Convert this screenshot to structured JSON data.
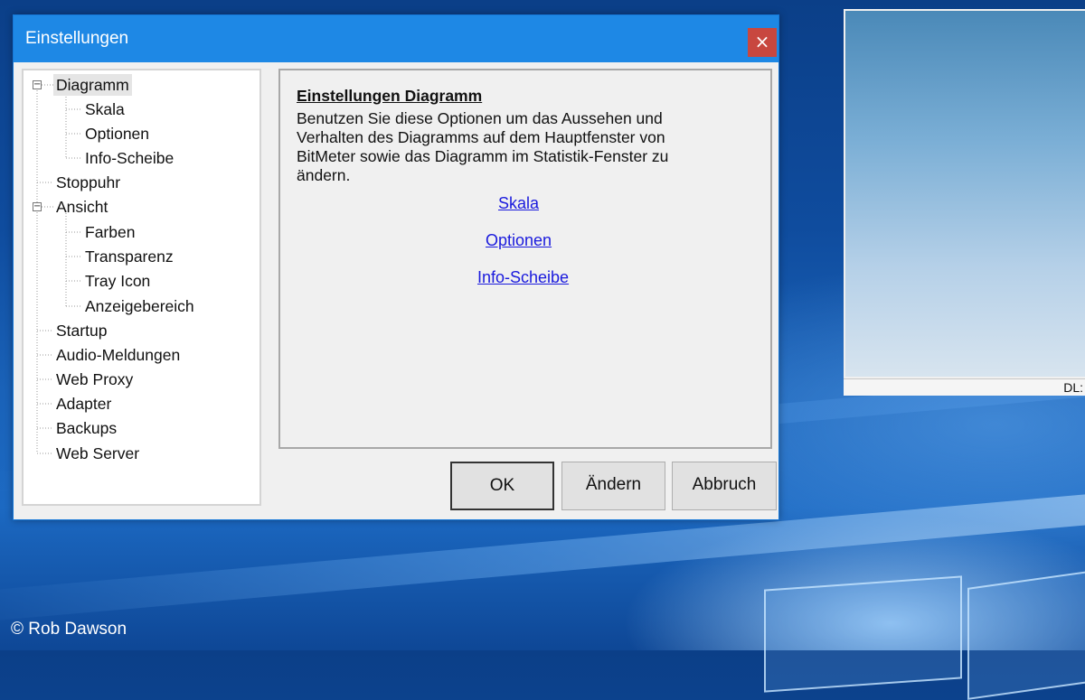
{
  "dialog": {
    "title": "Einstellungen",
    "close_glyph": "×",
    "buttons": {
      "ok": "OK",
      "apply": "Ändern",
      "cancel": "Abbruch"
    }
  },
  "tree": {
    "items": [
      {
        "label": "Diagramm",
        "expanded": true,
        "selected": true
      },
      {
        "label": "Skala"
      },
      {
        "label": "Optionen"
      },
      {
        "label": "Info-Scheibe"
      },
      {
        "label": "Stoppuhr"
      },
      {
        "label": "Ansicht",
        "expanded": true
      },
      {
        "label": "Farben"
      },
      {
        "label": "Transparenz"
      },
      {
        "label": "Tray Icon"
      },
      {
        "label": "Anzeigebereich"
      },
      {
        "label": "Startup"
      },
      {
        "label": "Audio-Meldungen"
      },
      {
        "label": "Web Proxy"
      },
      {
        "label": "Adapter"
      },
      {
        "label": "Backups"
      },
      {
        "label": "Web Server"
      }
    ],
    "expand_glyph": "−"
  },
  "panel": {
    "title": "Einstellungen Diagramm",
    "description": "Benutzen Sie diese Optionen um das Aussehen und Verhalten des Diagramms auf dem Hauptfenster von BitMeter sowie das Diagramm im Statistik-Fenster zu ändern.",
    "links": [
      "Skala",
      "Optionen",
      "Info-Scheibe"
    ]
  },
  "background_window": {
    "status_text": "DL:"
  },
  "watermark": "© Rob Dawson",
  "colors": {
    "titlebar": "#1e88e5",
    "close": "#c8473f",
    "link": "#1a1add"
  }
}
